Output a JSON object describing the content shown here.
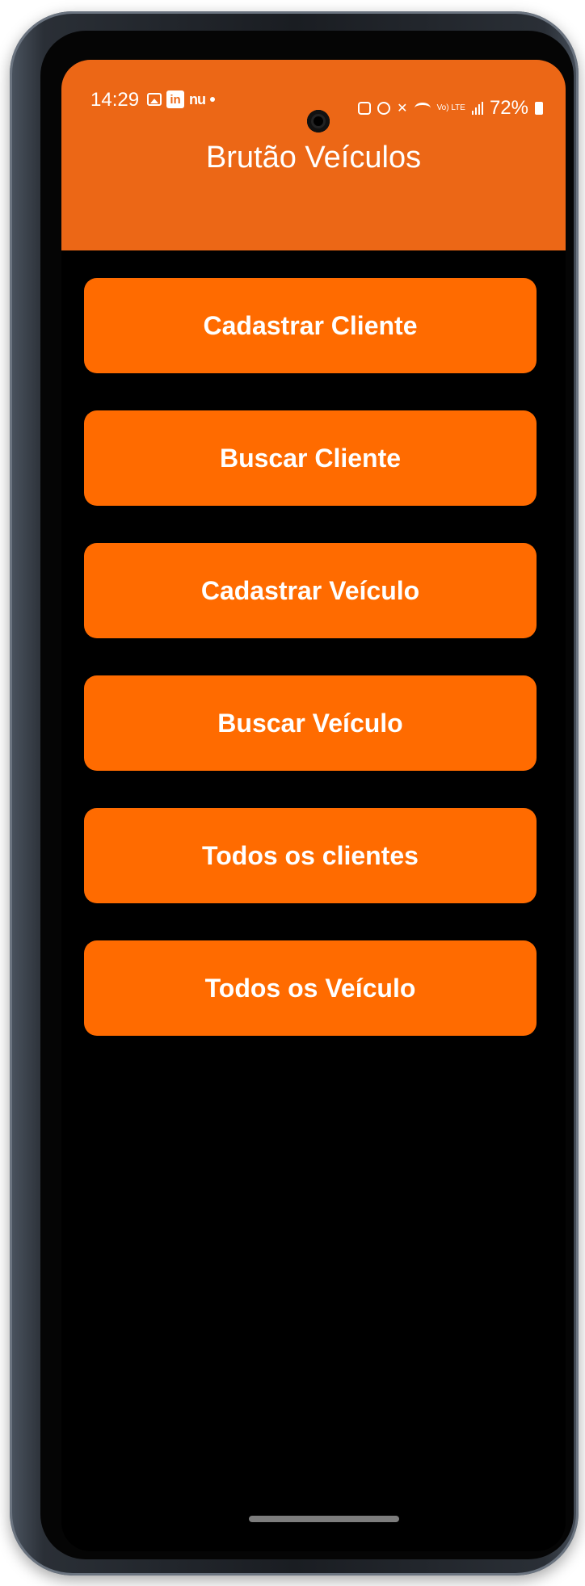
{
  "status_bar": {
    "time": "14:29",
    "left_icons": [
      "image-icon",
      "linkedin-icon",
      "nubank-icon",
      "dot-icon"
    ],
    "nubank_text": "nu",
    "linkedin_text": "in",
    "right_icons": [
      "sim-icon",
      "alarm-icon",
      "mute-icon",
      "wifi-icon",
      "volte-icon",
      "signal-icon",
      "battery-icon"
    ],
    "volte_text": "Vo) LTE",
    "battery": "72%"
  },
  "app_bar": {
    "title": "Brutão Veículos",
    "color": "#ec6716"
  },
  "menu": {
    "button_color": "#ff6b00",
    "items": [
      {
        "label": "Cadastrar Cliente"
      },
      {
        "label": "Buscar Cliente"
      },
      {
        "label": "Cadastrar Veículo"
      },
      {
        "label": "Buscar Veículo"
      },
      {
        "label": "Todos os clientes"
      },
      {
        "label": "Todos os Veículo"
      }
    ]
  }
}
